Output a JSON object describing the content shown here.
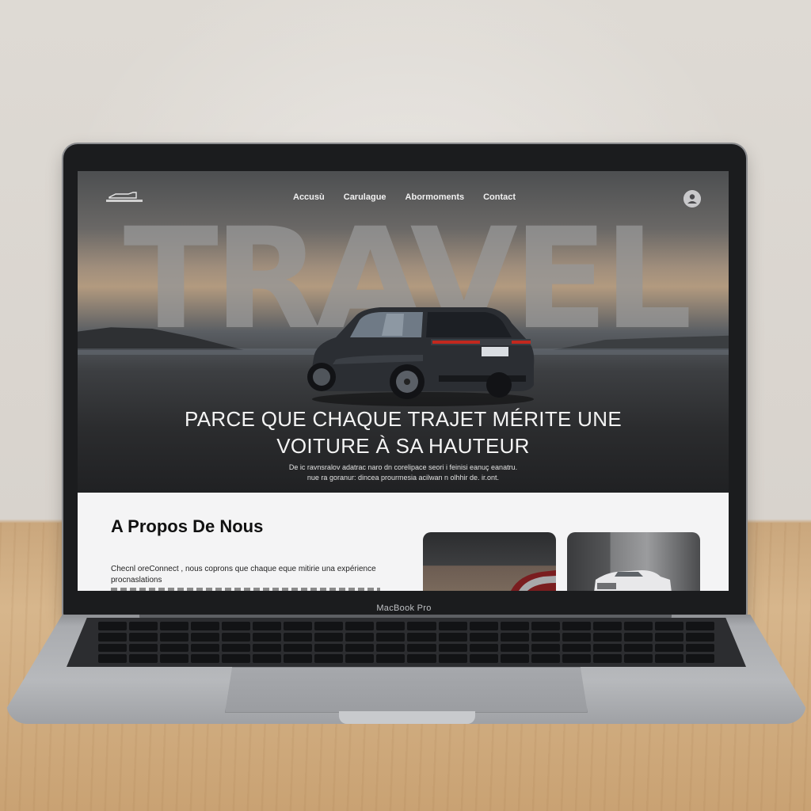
{
  "device": {
    "label": "MacBook Pro"
  },
  "site": {
    "nav": {
      "items": [
        {
          "label": "Accusù"
        },
        {
          "label": "Carulague"
        },
        {
          "label": "Abormoments"
        },
        {
          "label": "Contact"
        }
      ]
    },
    "hero": {
      "big_word": "TRAVEL",
      "headline_line1": "PARCE QUE CHAQUE TRAJET MÉRITE UNE",
      "headline_line2": "VOITURE À SA HAUTEUR",
      "sub_line1": "De ic ravnsralov adatrac naro dn corelipace seori i feinisi eanuç eanatru.",
      "sub_line2": "nue ra goranur: dincea prourmesia acilwan n olhhir de. ir.ont."
    },
    "about": {
      "title": "A Propos De Nous",
      "text_line1": "Checnl oreConnect , nous coprons que chaque eque mitirie una expérience",
      "text_line2": "procnaslations"
    }
  },
  "colors": {
    "accent_text": "#f4f4f4",
    "about_bg": "#f4f4f5"
  }
}
